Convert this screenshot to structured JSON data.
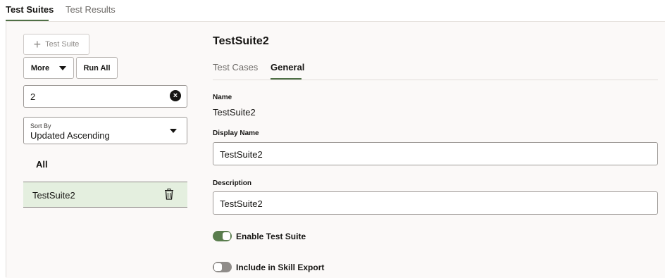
{
  "top_tabs": [
    {
      "label": "Test Suites",
      "active": true
    },
    {
      "label": "Test Results",
      "active": false
    }
  ],
  "left_panel": {
    "add_button_label": "Test Suite",
    "more_button_label": "More",
    "run_all_button_label": "Run All",
    "search_value": "2",
    "sort": {
      "label": "Sort By",
      "value": "Updated Ascending"
    },
    "all_label": "All",
    "suites": [
      {
        "name": "TestSuite2",
        "selected": true
      }
    ]
  },
  "right_panel": {
    "title": "TestSuite2",
    "tabs": [
      {
        "label": "Test Cases",
        "active": false
      },
      {
        "label": "General",
        "active": true
      }
    ],
    "name_label": "Name",
    "name_value": "TestSuite2",
    "display_name_label": "Display Name",
    "display_name_value": "TestSuite2",
    "description_label": "Description",
    "description_value": "TestSuite2",
    "enable_toggle": {
      "label": "Enable Test Suite",
      "on": true
    },
    "export_toggle": {
      "label": "Include in Skill Export",
      "on": false
    }
  },
  "colors": {
    "accent": "#4f6f46",
    "toggle_on": "#5a7d4e",
    "selected_row": "#e4efdf"
  },
  "icons": [
    "plus-icon",
    "chevron-down-icon",
    "clear-icon",
    "trash-icon"
  ]
}
